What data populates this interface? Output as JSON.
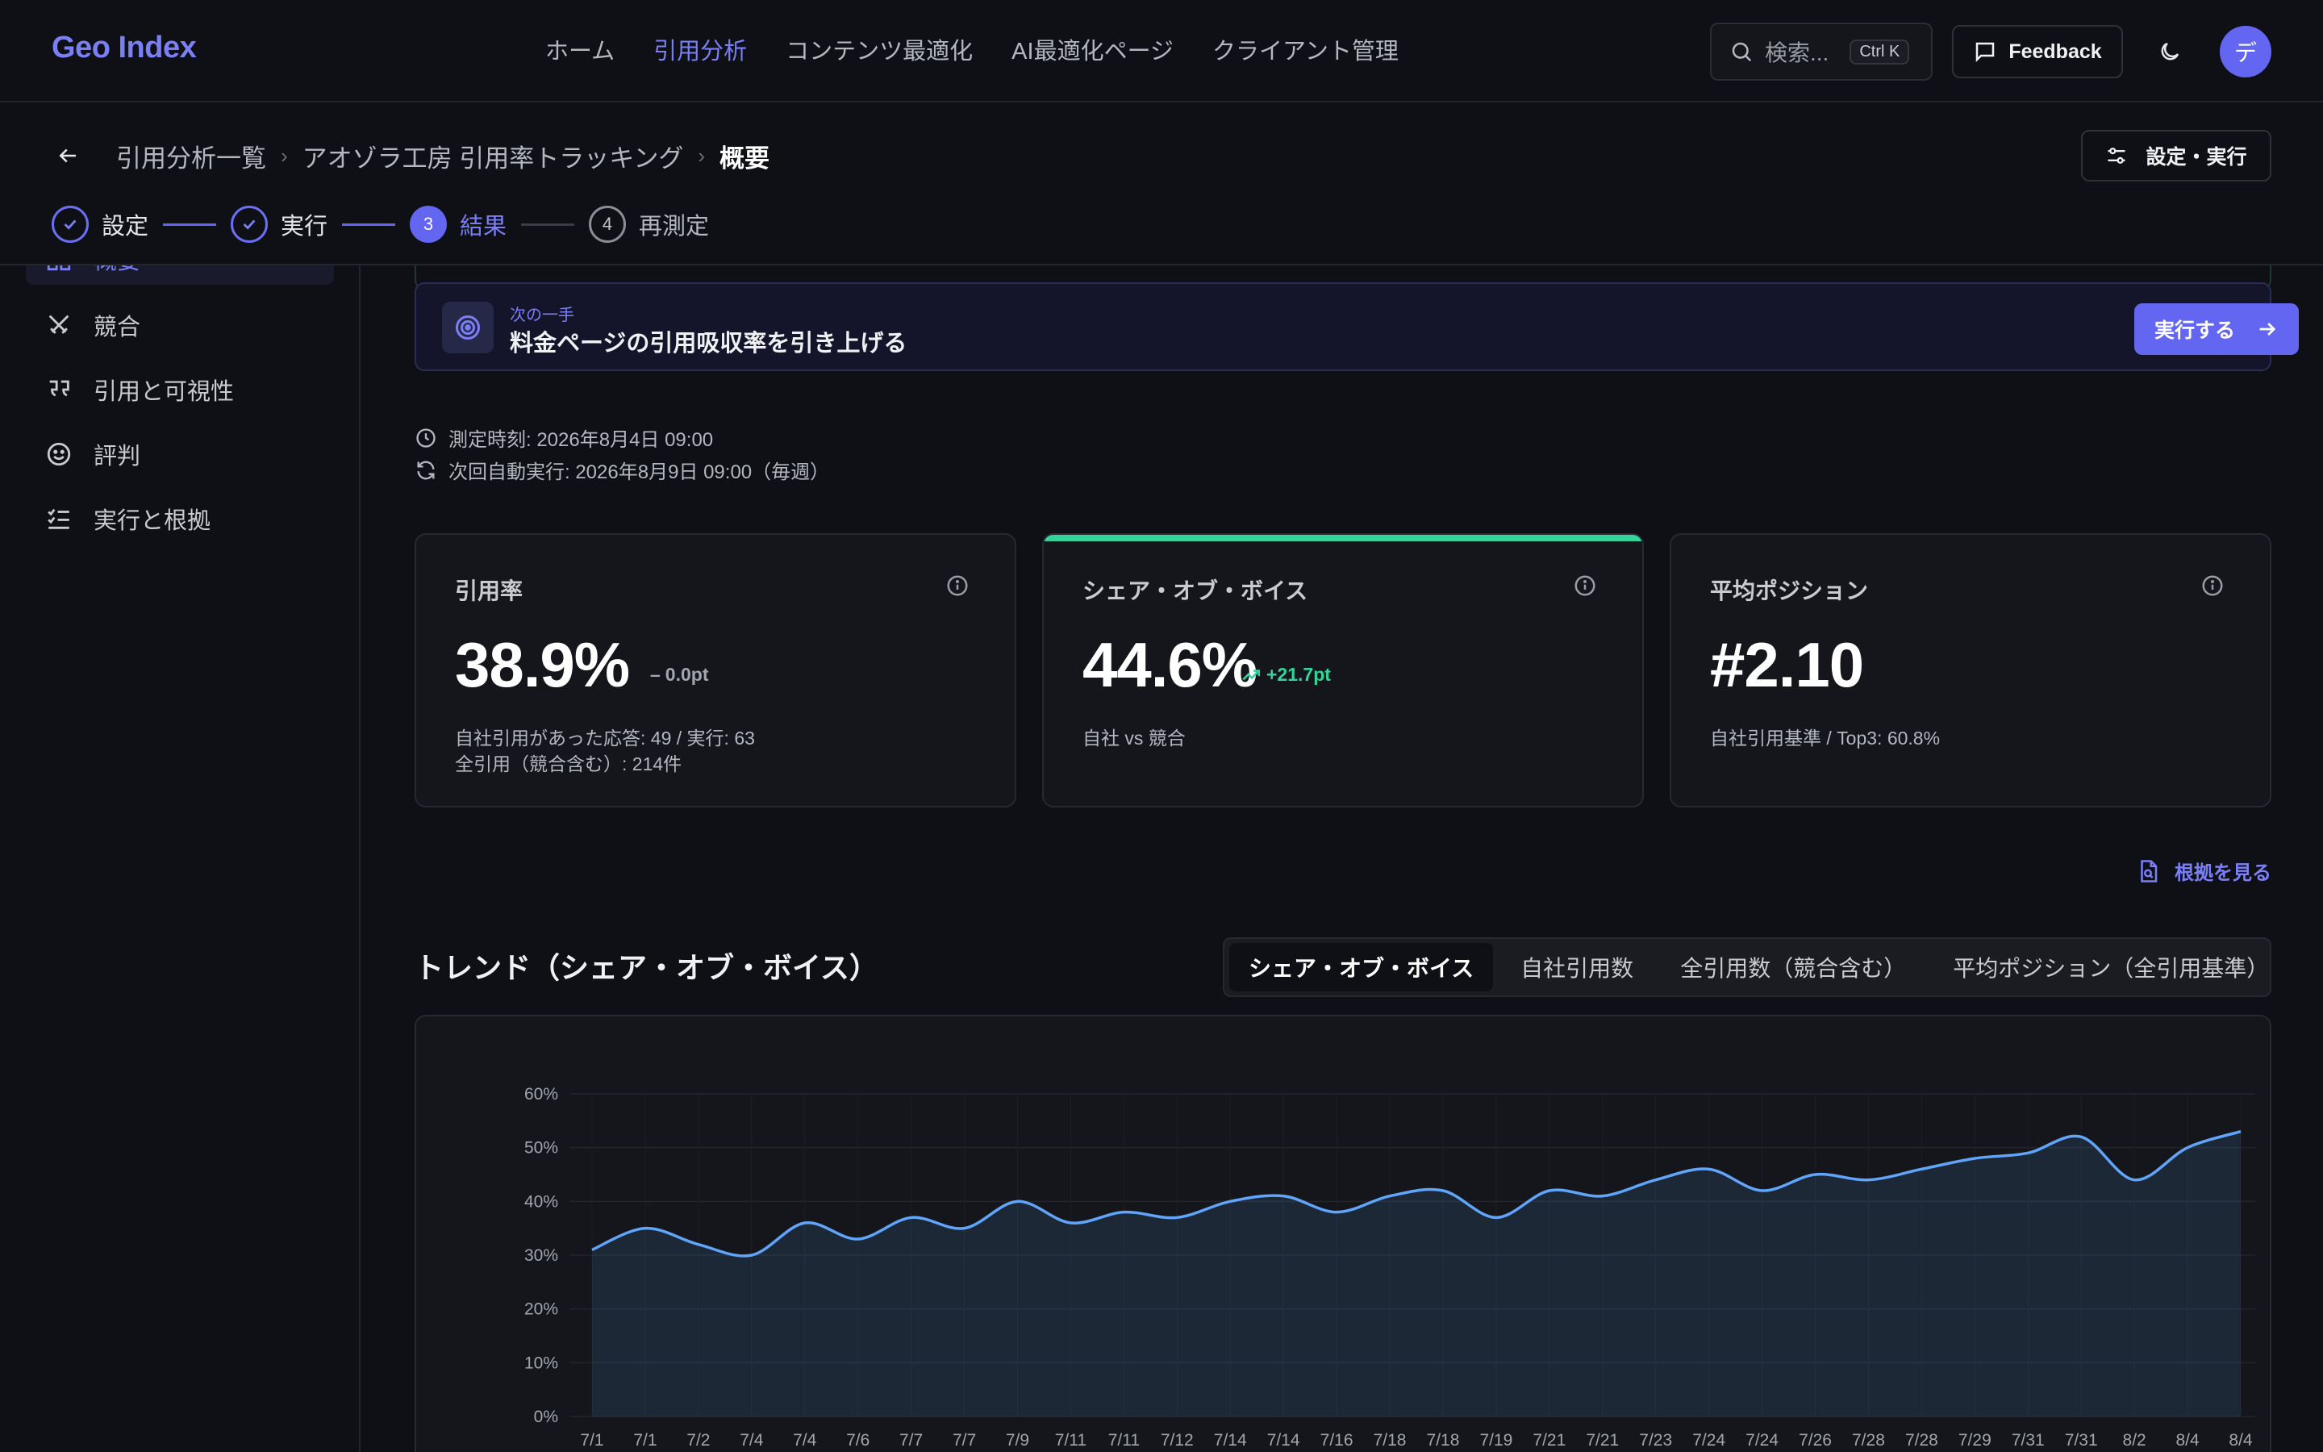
{
  "header": {
    "logo": "Geo Index",
    "nav": [
      {
        "label": "ホーム",
        "active": false
      },
      {
        "label": "引用分析",
        "active": true
      },
      {
        "label": "コンテンツ最適化",
        "active": false
      },
      {
        "label": "AI最適化ページ",
        "active": false
      },
      {
        "label": "クライアント管理",
        "active": false
      }
    ],
    "search_placeholder": "検索...",
    "search_shortcut": "Ctrl K",
    "feedback_label": "Feedback",
    "avatar_initial": "デ"
  },
  "page": {
    "breadcrumb": [
      "引用分析一覧",
      "アオゾラ工房 引用率トラッキング",
      "概要"
    ],
    "settings_button": "設定・実行",
    "steps": [
      {
        "label": "設定",
        "state": "done",
        "num": "1"
      },
      {
        "label": "実行",
        "state": "done",
        "num": "2"
      },
      {
        "label": "結果",
        "state": "active",
        "num": "3"
      },
      {
        "label": "再測定",
        "state": "todo",
        "num": "4"
      }
    ]
  },
  "sidebar": {
    "items": [
      {
        "label": "概要",
        "icon": "dashboard-icon",
        "active": true
      },
      {
        "label": "競合",
        "icon": "swords-icon",
        "active": false
      },
      {
        "label": "引用と可視性",
        "icon": "quote-icon",
        "active": false
      },
      {
        "label": "評判",
        "icon": "smile-icon",
        "active": false
      },
      {
        "label": "実行と根拠",
        "icon": "checklist-icon",
        "active": false
      }
    ]
  },
  "next_step": {
    "kicker": "次の一手",
    "title": "料金ページの引用吸収率を引き上げる",
    "button": "実行する"
  },
  "meta": {
    "measured": "測定時刻: 2026年8月4日 09:00",
    "next_run": "次回自動実行: 2026年8月9日 09:00（毎週）"
  },
  "metrics": [
    {
      "title": "引用率",
      "value": "38.9%",
      "delta": "0.0pt",
      "delta_kind": "flat",
      "sub1": "自社引用があった応答: 49 / 実行: 63",
      "sub2": "全引用（競合含む）: 214件"
    },
    {
      "title": "シェア・オブ・ボイス",
      "value": "44.6%",
      "delta": "+21.7pt",
      "delta_kind": "up",
      "sub1": "自社 vs 競合",
      "sub2": ""
    },
    {
      "title": "平均ポジション",
      "value": "#2.10",
      "delta": "",
      "delta_kind": "",
      "sub1": "自社引用基準 / Top3: 60.8%",
      "sub2": ""
    }
  ],
  "evidence_link": "根拠を見る",
  "trend": {
    "title": "トレンド（シェア・オブ・ボイス）",
    "tabs": [
      {
        "label": "シェア・オブ・ボイス",
        "active": true
      },
      {
        "label": "自社引用数",
        "active": false
      },
      {
        "label": "全引用数（競合含む）",
        "active": false
      },
      {
        "label": "平均ポジション（全引用基準）",
        "active": false
      }
    ]
  },
  "colors": {
    "accent": "#6366f1",
    "positive": "#34d399",
    "line": "#60a5fa"
  },
  "chart_data": {
    "type": "area",
    "ylim": [
      0,
      60
    ],
    "yticks": [
      "0%",
      "10%",
      "20%",
      "30%",
      "40%",
      "50%",
      "60%"
    ],
    "x": [
      "7/1",
      "7/1",
      "7/2",
      "7/4",
      "7/4",
      "7/6",
      "7/7",
      "7/7",
      "7/9",
      "7/11",
      "7/11",
      "7/12",
      "7/14",
      "7/14",
      "7/16",
      "7/18",
      "7/18",
      "7/19",
      "7/21",
      "7/21",
      "7/23",
      "7/24",
      "7/24",
      "7/26",
      "7/28",
      "7/28",
      "7/29",
      "7/31",
      "7/31",
      "8/2",
      "8/4",
      "8/4"
    ],
    "values": [
      31,
      35,
      32,
      30,
      36,
      33,
      37,
      35,
      40,
      36,
      38,
      37,
      40,
      41,
      38,
      41,
      42,
      37,
      42,
      41,
      44,
      46,
      42,
      45,
      44,
      46,
      48,
      49,
      52,
      44,
      50,
      53
    ]
  }
}
